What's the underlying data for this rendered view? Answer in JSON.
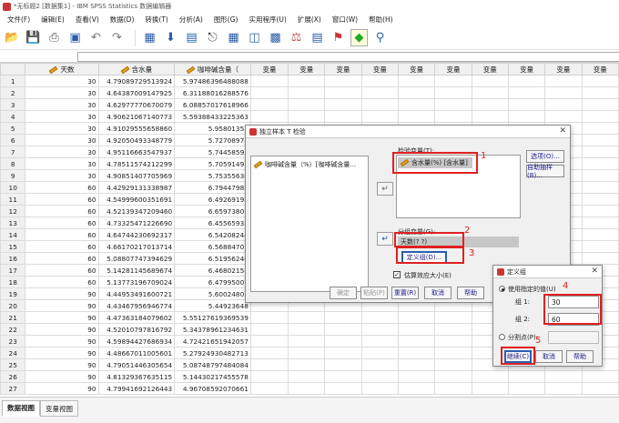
{
  "window": {
    "title": "*无标题2 [数据集1] - IBM SPSS Statistics 数据编辑器"
  },
  "menu": [
    "文件(F)",
    "编辑(E)",
    "查看(V)",
    "数据(D)",
    "转换(T)",
    "分析(A)",
    "图形(G)",
    "实用程序(U)",
    "扩展(X)",
    "窗口(W)",
    "帮助(H)"
  ],
  "toolbar_icons": [
    "open-folder-icon",
    "save-icon",
    "print-icon",
    "recall-dialog-icon",
    "undo-icon",
    "redo-icon",
    "goto-case-icon",
    "goto-variable-icon",
    "variables-icon",
    "find-icon",
    "insert-cases-icon",
    "insert-variable-icon",
    "split-file-icon",
    "weight-cases-icon",
    "select-cases-icon",
    "value-labels-icon",
    "use-sets-icon",
    "search-icon"
  ],
  "grid": {
    "columns": [
      "天数",
      "含水量",
      "咖啡碱含量（",
      "变量",
      "变量",
      "变量",
      "变量",
      "变量",
      "变量",
      "变量",
      "变量",
      "变量",
      "变量"
    ],
    "rows": [
      [
        "1",
        "30",
        "4.79089729513924",
        "5.97486396488088"
      ],
      [
        "2",
        "30",
        "4.64387009147925",
        "6.31188016288576"
      ],
      [
        "3",
        "30",
        "4.62977770670079",
        "6.08857017618966"
      ],
      [
        "4",
        "30",
        "4.90621067140773",
        "5.59388433225363"
      ],
      [
        "5",
        "30",
        "4.91029555658860",
        "5.95801352"
      ],
      [
        "6",
        "30",
        "4.92050493348779",
        "5.72708978"
      ],
      [
        "7",
        "30",
        "4.95116663547937",
        "5.74458595"
      ],
      [
        "8",
        "30",
        "4.78511574212299",
        "5.70591491"
      ],
      [
        "9",
        "30",
        "4.90851407705969",
        "5.75355636"
      ],
      [
        "10",
        "60",
        "4.42929131338987",
        "6.79447982"
      ],
      [
        "11",
        "60",
        "4.54999600351691",
        "6.49269192"
      ],
      [
        "12",
        "60",
        "4.52139347209460",
        "6.65973807"
      ],
      [
        "13",
        "60",
        "4.73325471226690",
        "6.45565935"
      ],
      [
        "14",
        "60",
        "4.64744230692317",
        "6.54208244"
      ],
      [
        "15",
        "60",
        "4.66170217013714",
        "6.56884701"
      ],
      [
        "16",
        "60",
        "5.08807747394629",
        "6.51956240"
      ],
      [
        "17",
        "60",
        "5.14281145689674",
        "6.46802158"
      ],
      [
        "18",
        "60",
        "5.13773196709024",
        "6.47995007"
      ],
      [
        "19",
        "90",
        "4.44953491600721",
        "5.60024803"
      ],
      [
        "20",
        "90",
        "4.43467956946774",
        "5.44923648"
      ],
      [
        "21",
        "90",
        "4.47363184079602",
        "5.55127619369539"
      ],
      [
        "22",
        "90",
        "4.52010797816792",
        "5.34378961234631"
      ],
      [
        "23",
        "90",
        "4.59894427686934",
        "4.72421651942057"
      ],
      [
        "24",
        "90",
        "4.48667011005601",
        "5.27924930482713"
      ],
      [
        "25",
        "90",
        "4.79051446305654",
        "5.08748797484084"
      ],
      [
        "26",
        "90",
        "4.81329367635115",
        "5.14430217455578"
      ],
      [
        "27",
        "90",
        "4.79941692126443",
        "4.96708592070661"
      ]
    ]
  },
  "tabs": {
    "data_view": "数据视图",
    "variable_view": "变量视图"
  },
  "ttest_dialog": {
    "title": "独立样本 T 检验",
    "source_item": "咖啡碱含量（%）[咖啡碱含量...",
    "test_var_label": "检验变量(T):",
    "test_var_item": "含水量(%) [含水量]",
    "group_var_label": "分组变量(G):",
    "group_var_value": "天数(? ?)",
    "define_groups": "定义组(D)...",
    "options": "选项(O)...",
    "bootstrap": "自助抽样(B)...",
    "effect_size": "估算效应大小(E)",
    "ok": "确定",
    "paste": "粘贴(P)",
    "reset": "重置(R)",
    "cancel": "取消",
    "help": "帮助"
  },
  "define_dialog": {
    "title": "定义组",
    "use_specified": "使用指定的值(U)",
    "group1_label": "组 1:",
    "group1_value": "30",
    "group2_label": "组 2:",
    "group2_value": "60",
    "cutpoint": "分割点(P):",
    "continue": "继续(C)",
    "cancel": "取消",
    "help": "帮助"
  },
  "annotations": [
    "1",
    "2",
    "3",
    "4",
    "5"
  ]
}
